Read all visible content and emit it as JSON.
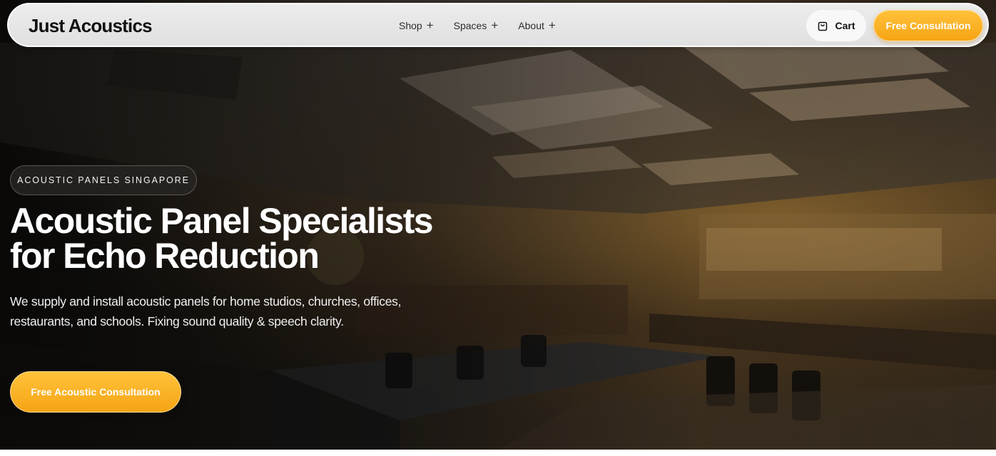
{
  "brand": {
    "name": "Just Acoustics"
  },
  "nav": {
    "links": [
      {
        "label": "Shop",
        "icon": "plus-icon"
      },
      {
        "label": "Spaces",
        "icon": "plus-icon"
      },
      {
        "label": "About",
        "icon": "plus-icon"
      }
    ],
    "cart_label": "Cart",
    "cart_icon": "shopping-bag-icon",
    "consult_label": "Free Consultation"
  },
  "hero": {
    "badge": "ACOUSTIC PANELS SINGAPORE",
    "headline_line1": "Acoustic Panel Specialists",
    "headline_line2": "for Echo Reduction",
    "subtext": "We supply and install acoustic panels for home studios, churches, offices, restaurants, and schools. Fixing sound quality & speech clarity.",
    "cta_label": "Free Acoustic Consultation"
  },
  "colors": {
    "accent": "#f6a414",
    "accent_light": "#ffc23a",
    "nav_bg": "#e6e6e6",
    "text_dark": "#111111"
  }
}
